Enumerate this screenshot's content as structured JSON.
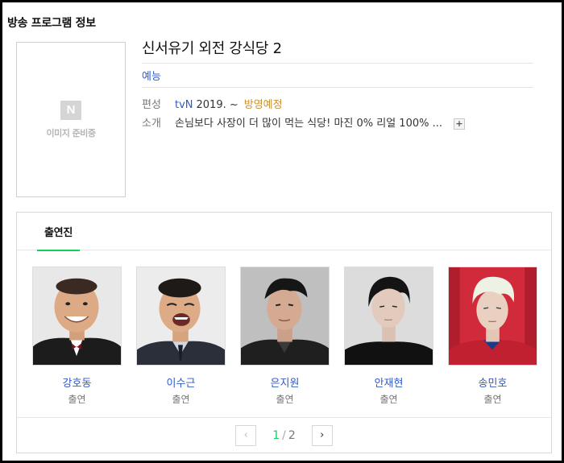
{
  "section_title": "방송 프로그램 정보",
  "poster": {
    "logo": "N",
    "placeholder_text": "이미지 준비중"
  },
  "program": {
    "title": "신서유기 외전 강식당 2",
    "genre": "예능",
    "schedule_label": "편성",
    "channel": "tvN",
    "date": "2019. ~",
    "status": "방영예정",
    "intro_label": "소개",
    "intro": "손님보다 사장이 더 많이 먹는 식당! 마진 0% 리얼 100% ...",
    "more_icon": "plus-icon",
    "more_symbol": "+"
  },
  "cast": {
    "tab_label": "출연진",
    "members": [
      {
        "name": "강호동",
        "role": "출연"
      },
      {
        "name": "이수근",
        "role": "출연"
      },
      {
        "name": "은지원",
        "role": "출연"
      },
      {
        "name": "안재현",
        "role": "출연"
      },
      {
        "name": "송민호",
        "role": "출연"
      }
    ]
  },
  "pagination": {
    "current": "1",
    "separator": "/",
    "total": "2",
    "prev_icon": "chevron-left-icon",
    "next_icon": "chevron-right-icon",
    "prev_symbol": "‹",
    "next_symbol": "›"
  },
  "colors": {
    "link_blue": "#2f5bc5",
    "accent_green": "#19ce60",
    "status_gold": "#c8902e"
  }
}
